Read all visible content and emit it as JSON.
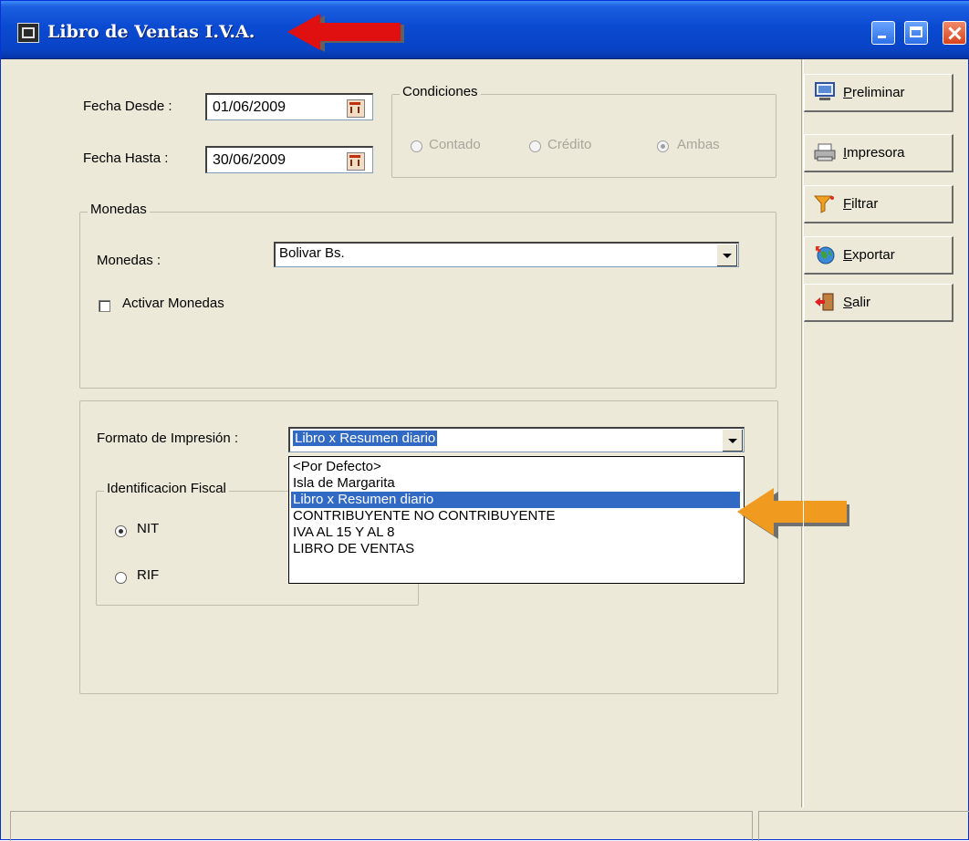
{
  "window": {
    "title": "Libro de Ventas I.V.A."
  },
  "dates": {
    "desde_label": "Fecha Desde :",
    "desde_value": "01/06/2009",
    "hasta_label": "Fecha Hasta :",
    "hasta_value": "30/06/2009"
  },
  "condiciones": {
    "title": "Condiciones",
    "options": [
      {
        "label": "Contado",
        "selected": false
      },
      {
        "label": "Crédito",
        "selected": false
      },
      {
        "label": "Ambas",
        "selected": true
      }
    ]
  },
  "monedas": {
    "group_title": "Monedas",
    "label": "Monedas :",
    "selected": "Bolivar Bs.",
    "activar_label": "Activar Monedas",
    "activar_checked": false
  },
  "formato": {
    "label": "Formato de Impresión :",
    "selected": "Libro x Resumen diario",
    "options": [
      "<Por Defecto>",
      "Isla de Margarita",
      "Libro x Resumen diario",
      "CONTRIBUYENTE NO CONTRIBUYENTE",
      "IVA AL 15 Y AL 8",
      "LIBRO DE VENTAS"
    ],
    "highlighted_index": 2
  },
  "identificacion": {
    "title": "Identificacion Fiscal",
    "options": [
      {
        "label": "NIT",
        "selected": true
      },
      {
        "label": "RIF",
        "selected": false
      }
    ]
  },
  "side_buttons": [
    {
      "label": "Preliminar",
      "icon": "monitor-icon"
    },
    {
      "label": "Impresora",
      "icon": "printer-icon"
    },
    {
      "label": "Filtrar",
      "icon": "funnel-icon"
    },
    {
      "label": "Exportar",
      "icon": "globe-icon"
    },
    {
      "label": "Salir",
      "icon": "exit-door-icon"
    }
  ],
  "colors": {
    "titlebar": "#0843c4",
    "window_face": "#ece9d8",
    "selection": "#316ac5",
    "annotation_red": "#e01010",
    "annotation_orange": "#f09a20"
  }
}
